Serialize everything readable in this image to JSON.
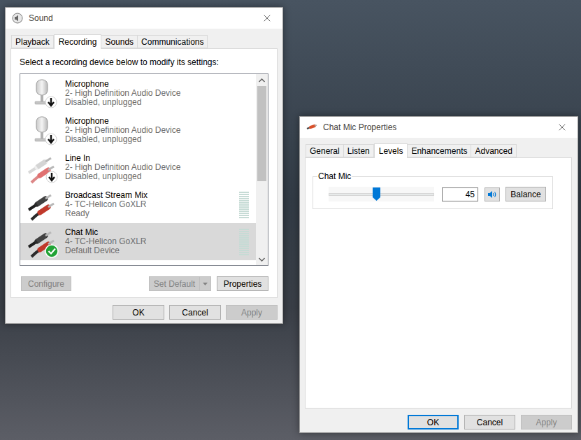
{
  "sound_window": {
    "title": "Sound",
    "tabs": [
      {
        "label": "Playback",
        "selected": false
      },
      {
        "label": "Recording",
        "selected": true
      },
      {
        "label": "Sounds",
        "selected": false
      },
      {
        "label": "Communications",
        "selected": false
      }
    ],
    "instruction": "Select a recording device below to modify its settings:",
    "devices": [
      {
        "name": "Microphone",
        "driver": "2- High Definition Audio Device",
        "status": "Disabled, unplugged",
        "kind": "microphone",
        "disabled": true,
        "default": false,
        "selected": false,
        "meter": false,
        "meter_level": 0
      },
      {
        "name": "Microphone",
        "driver": "2- High Definition Audio Device",
        "status": "Disabled, unplugged",
        "kind": "microphone",
        "disabled": true,
        "default": false,
        "selected": false,
        "meter": false,
        "meter_level": 0
      },
      {
        "name": "Line In",
        "driver": "2- High Definition Audio Device",
        "status": "Disabled, unplugged",
        "kind": "line-in",
        "disabled": true,
        "default": false,
        "selected": false,
        "meter": false,
        "meter_level": 0
      },
      {
        "name": "Broadcast Stream Mix",
        "driver": "4- TC-Helicon GoXLR",
        "status": "Ready",
        "kind": "stereo",
        "disabled": false,
        "default": false,
        "selected": false,
        "meter": true,
        "meter_level": 0
      },
      {
        "name": "Chat Mic",
        "driver": "4- TC-Helicon GoXLR",
        "status": "Default Device",
        "kind": "stereo",
        "disabled": false,
        "default": true,
        "selected": true,
        "meter": true,
        "meter_level": 0
      }
    ],
    "buttons": [
      {
        "label": "Configure",
        "disabled": true
      },
      {
        "label": "Set Default",
        "disabled": true
      },
      {
        "label": "Properties",
        "disabled": false
      }
    ],
    "footer_buttons": [
      {
        "label": "OK",
        "disabled": false,
        "default": false
      },
      {
        "label": "Cancel",
        "disabled": false,
        "default": false
      },
      {
        "label": "Apply",
        "disabled": true,
        "default": false
      }
    ]
  },
  "properties_window": {
    "title": "Chat Mic Properties",
    "tabs": [
      {
        "label": "General",
        "selected": false
      },
      {
        "label": "Listen",
        "selected": false
      },
      {
        "label": "Levels",
        "selected": true
      },
      {
        "label": "Enhancements",
        "selected": false
      },
      {
        "label": "Advanced",
        "selected": false
      }
    ],
    "group": {
      "label": "Chat Mic",
      "level": 0.45,
      "value": "45",
      "muted": false,
      "balance_button": "Balance"
    },
    "footer_buttons": [
      {
        "label": "OK",
        "disabled": false,
        "default": true
      },
      {
        "label": "Cancel",
        "disabled": false,
        "default": false
      },
      {
        "label": "Apply",
        "disabled": true,
        "default": false
      }
    ]
  }
}
